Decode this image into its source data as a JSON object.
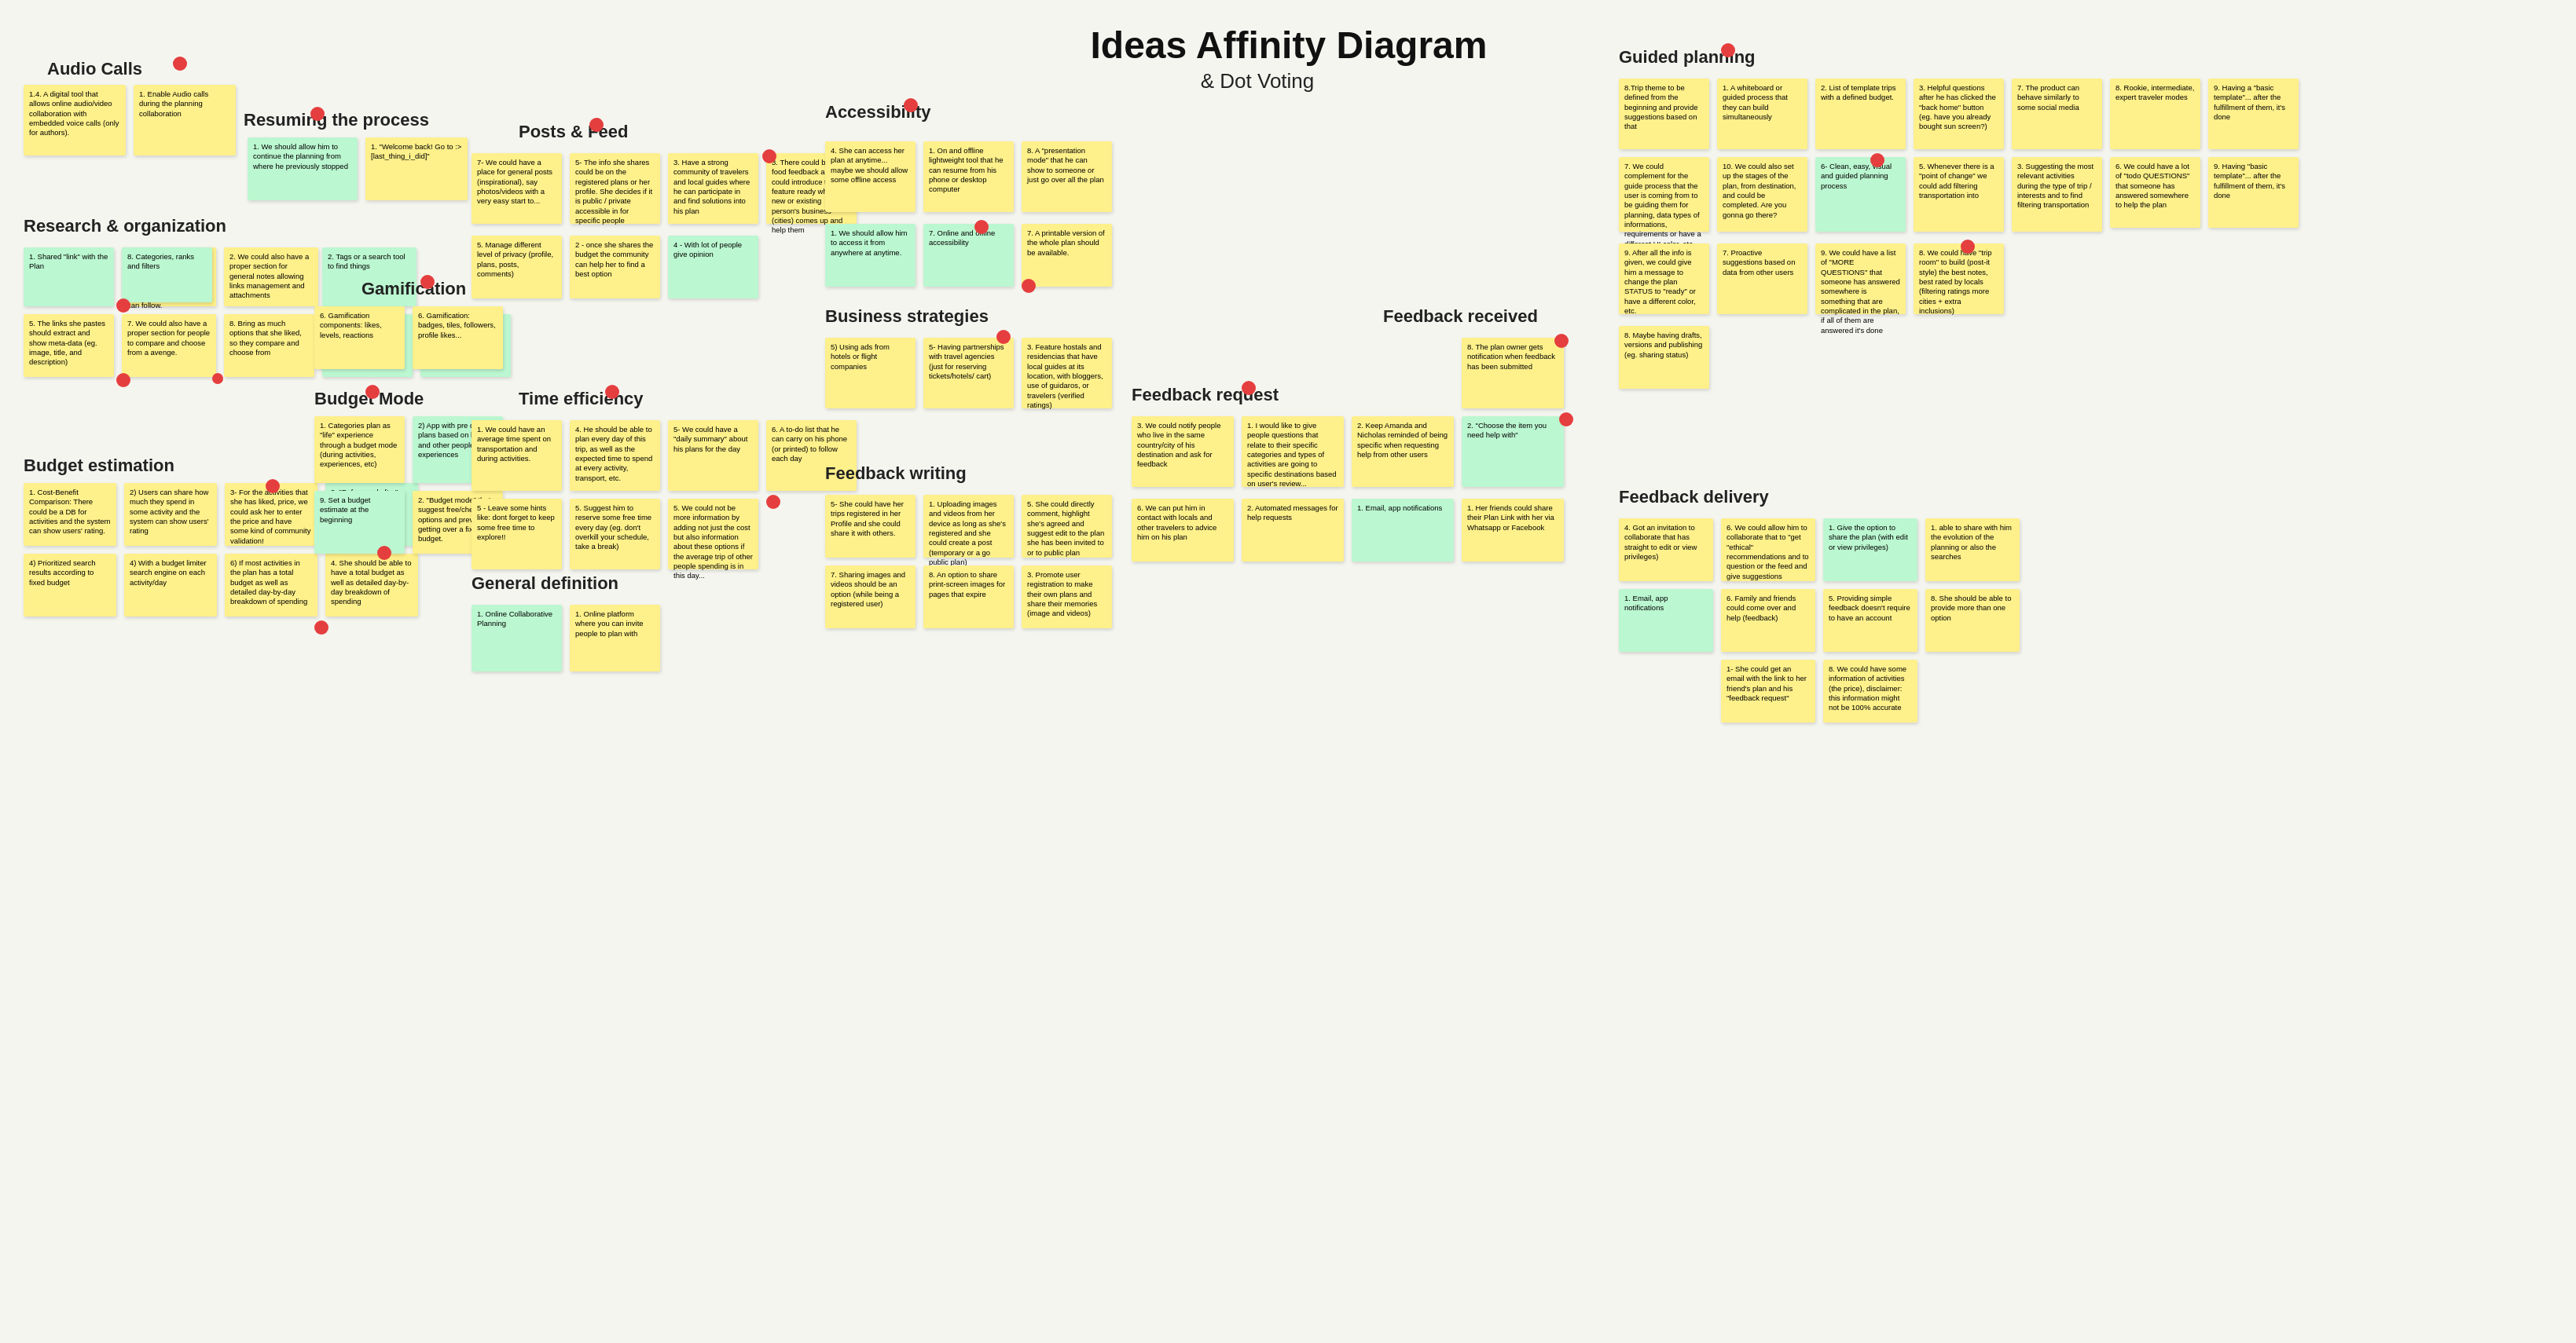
{
  "title": "Ideas Affinity Diagram",
  "subtitle": "& Dot Voting",
  "sections": {
    "audio_calls": "Audio Calls",
    "resuming": "Resuming the process",
    "posts_feed": "Posts & Feed",
    "accessibility": "Accessibility",
    "guided_planning": "Guided planning",
    "research": "Research & organization",
    "gamification": "Gamification",
    "business": "Business strategies",
    "feedback_received": "Feedback received",
    "feedback_request": "Feedback request",
    "budget_mode": "Budget Mode",
    "time_efficiency": "Time efficiency",
    "feedback_writing": "Feedback writing",
    "budget_estimation": "Budget estimation",
    "general_definition": "General definition",
    "feedback_delivery": "Feedback delivery"
  }
}
